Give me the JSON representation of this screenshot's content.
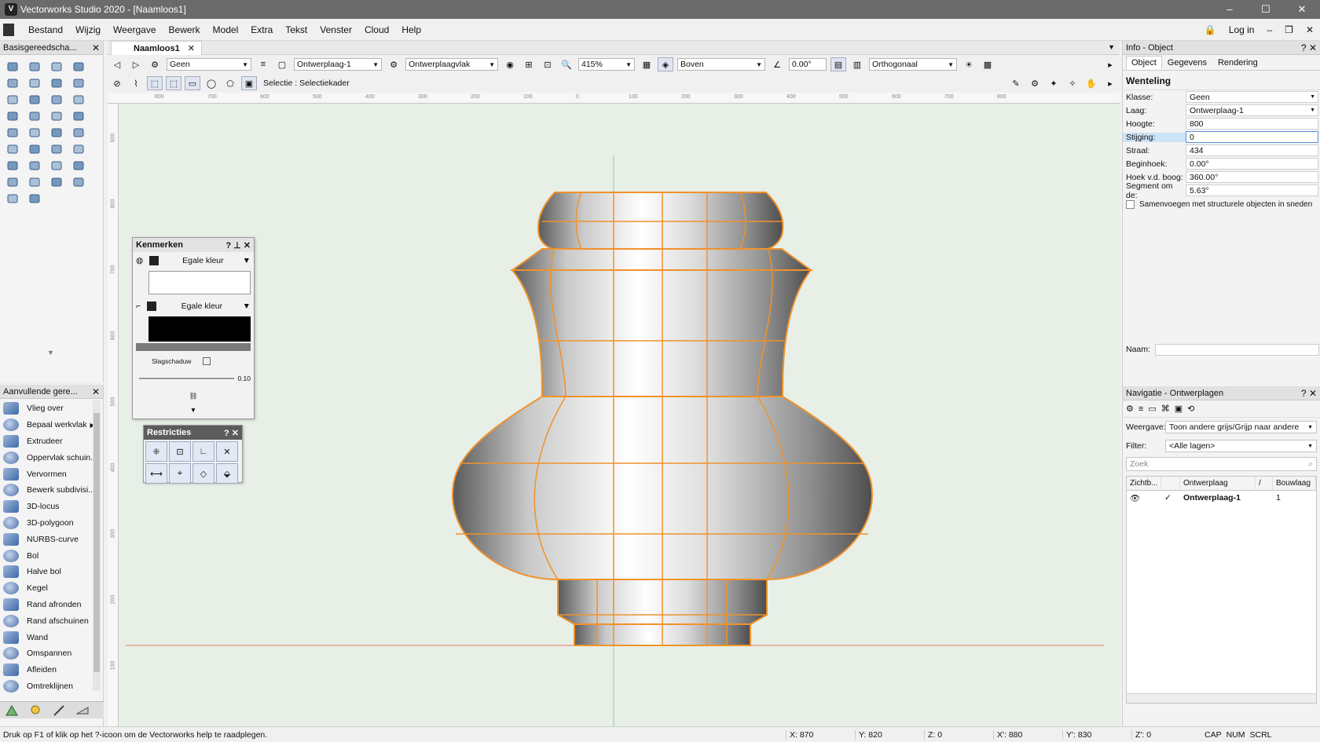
{
  "window": {
    "title": "Vectorworks Studio 2020 - [Naamloos1]",
    "controls": [
      "–",
      "☐",
      "✕"
    ]
  },
  "menu": {
    "items": [
      "Bestand",
      "Wijzig",
      "Weergave",
      "Bewerk",
      "Model",
      "Extra",
      "Tekst",
      "Venster",
      "Cloud",
      "Help"
    ],
    "login": "Log in"
  },
  "left_palette": {
    "title": "Basisgereedscha...",
    "tools": [
      "select-arrow",
      "pan-hand",
      "flyover",
      "zoom",
      "text",
      "callout",
      "x-mark",
      "3d-box",
      "line",
      "double-line",
      "rectangle",
      "rounded-rect",
      "circle",
      "oval",
      "arc",
      "fillet",
      "polygon",
      "polyline",
      "freehand",
      "hexagon",
      "spiral",
      "eyedropper",
      "mirror",
      "attribute",
      "rotate",
      "mirror2",
      "pen",
      "split",
      "scissors",
      "reshape",
      "corner",
      "offset",
      "eraser",
      "clip"
    ]
  },
  "extra_palette": {
    "title": "Aanvullende gere...",
    "items": [
      "Vlieg over",
      "Bepaal werkvlak",
      "Extrudeer",
      "Oppervlak schuin...",
      "Vervormen",
      "Bewerk subdivisi...",
      "3D-locus",
      "3D-polygoon",
      "NURBS-curve",
      "Bol",
      "Halve bol",
      "Kegel",
      "Rand afronden",
      "Rand afschuinen",
      "Wand",
      "Omspannen",
      "Afleiden",
      "Omtreklijnen"
    ]
  },
  "document_tab": {
    "label": "Naamloos1"
  },
  "toolbar": {
    "class": "Geen",
    "layer": "Ontwerplaag-1",
    "plane": "Ontwerplaagvlak",
    "zoom": "415%",
    "view": "Boven",
    "angle": "0.00°",
    "projection": "Orthogonaal",
    "mode_text": "Selectie : Selectiekader"
  },
  "ruler": {
    "h_ticks": [
      "800",
      "700",
      "600",
      "500",
      "400",
      "300",
      "200",
      "100",
      "0",
      "100",
      "200",
      "300",
      "400",
      "500",
      "600",
      "700",
      "800"
    ],
    "v_ticks": [
      "900",
      "800",
      "700",
      "600",
      "500",
      "400",
      "300",
      "200",
      "100"
    ]
  },
  "kenmerken": {
    "title": "Kenmerken",
    "fill_label": "Egale kleur",
    "line_label": "Egale kleur",
    "shadow_label": "Slagschaduw",
    "opacity": "0.10"
  },
  "restricties": {
    "title": "Restricties"
  },
  "info": {
    "title": "Info - Object",
    "tabs": [
      "Object",
      "Gegevens",
      "Rendering"
    ],
    "object_type": "Wenteling",
    "properties": [
      {
        "key": "Klasse:",
        "value": "Geen"
      },
      {
        "key": "Laag:",
        "value": "Ontwerplaag-1"
      },
      {
        "key": "Hoogte:",
        "value": "800"
      },
      {
        "key": "Stijging:",
        "value": "0"
      },
      {
        "key": "Straal:",
        "value": "434"
      },
      {
        "key": "Beginhoek:",
        "value": "0.00°"
      },
      {
        "key": "Hoek v.d. boog:",
        "value": "360.00°"
      },
      {
        "key": "Segment om de:",
        "value": "5.63°"
      }
    ],
    "checkbox_label": "Samenvoegen met structurele objecten in sneden",
    "name_label": "Naam:"
  },
  "navigation": {
    "title": "Navigatie - Ontwerplagen",
    "view_label": "Weergave:",
    "view_value": "Toon andere grijs/Grijp naar andere",
    "filter_label": "Filter:",
    "filter_value": "<Alle lagen>",
    "search_placeholder": "Zoek",
    "columns": [
      "Zichtb...",
      "Ontwerplaag",
      "/",
      "Bouwlaag"
    ],
    "rows": [
      {
        "layer": "Ontwerplaag-1",
        "story": "1"
      }
    ]
  },
  "status": {
    "help": "Druk op F1 of klik op het ?-icoon om de Vectorworks help te raadplegen.",
    "x": "X: 870",
    "y": "Y: 820",
    "z": "Z: 0",
    "x2": "X': 880",
    "y2": "Y': 830",
    "z2": "Z': 0",
    "flags": [
      "CAP",
      "NUM",
      "SCRL"
    ]
  },
  "colors": {
    "accent": "#f0922b",
    "canvas": "#e7efe7",
    "guide_green": "#8fd08f",
    "guide_red": "#e87b6b"
  }
}
